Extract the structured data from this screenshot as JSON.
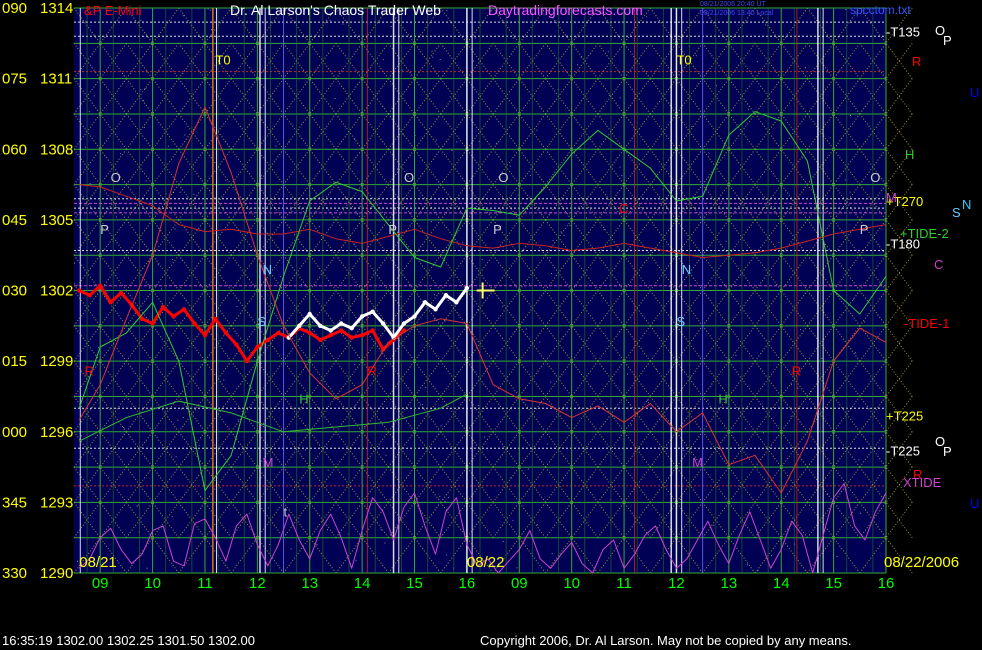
{
  "header": {
    "symbol": "&P E-Mini",
    "title": "Dr. Al Larson's Chaos Trader Web",
    "site": "Daytradingforecasts.com",
    "stamp1": "08/21/2006 20:40 UT",
    "stamp2": "08/21/2006 13:40 Local",
    "file": "spcctom.txt"
  },
  "footer": {
    "quote": "16:35:19  1302.00  1302.25  1301.50  1302.00",
    "copyright": "Copyright 2006, Dr. Al Larson. May not be copied by any means."
  },
  "colors": {
    "background": "#000055",
    "outer": "#000000",
    "yaxis_text": "#FFFF00",
    "time_text": "#00FF00",
    "price_line": "#FF0000",
    "price_bar_white": "#FFFFFF",
    "grid_green": "#33AA33",
    "grid_yellow": "#CCCC33",
    "tide_magenta": "#CC44CC"
  },
  "chart_data": {
    "type": "line",
    "title": "Dr. Al Larson's Chaos Trader Web",
    "ylim": [
      1290,
      1314
    ],
    "y_ticks": [
      {
        "deg": "090",
        "price": "1314",
        "value": 1314
      },
      {
        "deg": "075",
        "price": "1311",
        "value": 1311
      },
      {
        "deg": "060",
        "price": "1308",
        "value": 1308
      },
      {
        "deg": "045",
        "price": "1305",
        "value": 1305
      },
      {
        "deg": "030",
        "price": "1302",
        "value": 1302
      },
      {
        "deg": "015",
        "price": "1299",
        "value": 1299
      },
      {
        "deg": "000",
        "price": "1296",
        "value": 1296
      },
      {
        "deg": "345",
        "price": "1293",
        "value": 1293
      },
      {
        "deg": "330",
        "price": "1290",
        "value": 1290
      }
    ],
    "xlim": [
      8.5,
      24
    ],
    "x_ticks": [
      {
        "label": "09",
        "x": 9
      },
      {
        "label": "10",
        "x": 10
      },
      {
        "label": "11",
        "x": 11
      },
      {
        "label": "12",
        "x": 12
      },
      {
        "label": "13",
        "x": 13
      },
      {
        "label": "14",
        "x": 14
      },
      {
        "label": "15",
        "x": 15
      },
      {
        "label": "16",
        "x": 16
      },
      {
        "label": "09",
        "x": 17
      },
      {
        "label": "10",
        "x": 18
      },
      {
        "label": "11",
        "x": 19
      },
      {
        "label": "12",
        "x": 20
      },
      {
        "label": "13",
        "x": 21
      },
      {
        "label": "14",
        "x": 22
      },
      {
        "label": "15",
        "x": 23
      },
      {
        "label": "16",
        "x": 24
      }
    ],
    "date_labels": [
      {
        "text": "08/21",
        "x": 8.6
      },
      {
        "text": "08/22",
        "x": 16.0
      },
      {
        "text": "08/22/2006",
        "x": 24
      }
    ],
    "right_labels": [
      {
        "text": "-T135",
        "y": 1313.0,
        "color": "#FFFFFF"
      },
      {
        "text": "+T270",
        "y": 1305.8,
        "color": "#FFFF00"
      },
      {
        "text": "-T180",
        "y": 1304.0,
        "color": "#FFFFFF"
      },
      {
        "text": "+T225",
        "y": 1296.7,
        "color": "#FFFF00"
      },
      {
        "text": "-T225",
        "y": 1295.2,
        "color": "#FFFFFF"
      }
    ],
    "markers": [
      {
        "text": "T0",
        "x": 11.2,
        "y": 1311.6,
        "color": "#FFFF00"
      },
      {
        "text": "T0",
        "x": 20.0,
        "y": 1311.6,
        "color": "#FFFF00"
      },
      {
        "text": "O",
        "x": 9.2,
        "y": 1306.6,
        "color": "#CCCCCC"
      },
      {
        "text": "O",
        "x": 14.8,
        "y": 1306.6,
        "color": "#CCCCCC"
      },
      {
        "text": "O",
        "x": 16.6,
        "y": 1306.6,
        "color": "#CCCCCC"
      },
      {
        "text": "O",
        "x": 23.7,
        "y": 1306.6,
        "color": "#CCCCCC"
      },
      {
        "text": "P",
        "x": 9.0,
        "y": 1304.4,
        "color": "#CCCCCC"
      },
      {
        "text": "P",
        "x": 14.5,
        "y": 1304.4,
        "color": "#CCCCCC"
      },
      {
        "text": "P",
        "x": 16.5,
        "y": 1304.4,
        "color": "#CCCCCC"
      },
      {
        "text": "P",
        "x": 23.5,
        "y": 1304.4,
        "color": "#CCCCCC"
      },
      {
        "text": "N",
        "x": 12.1,
        "y": 1302.7,
        "color": "#66CCFF"
      },
      {
        "text": "N",
        "x": 20.1,
        "y": 1302.7,
        "color": "#66CCFF"
      },
      {
        "text": "S",
        "x": 12.0,
        "y": 1300.5,
        "color": "#66CCFF"
      },
      {
        "text": "S",
        "x": 20.0,
        "y": 1300.5,
        "color": "#66CCFF"
      },
      {
        "text": "R",
        "x": 8.7,
        "y": 1298.4,
        "color": "#FF0000"
      },
      {
        "text": "R",
        "x": 14.1,
        "y": 1298.4,
        "color": "#FF0000"
      },
      {
        "text": "R",
        "x": 22.2,
        "y": 1298.4,
        "color": "#FF0000"
      },
      {
        "text": "C",
        "x": 18.9,
        "y": 1305.3,
        "color": "#FF0000"
      },
      {
        "text": "H",
        "x": 12.8,
        "y": 1297.2,
        "color": "#33CC33"
      },
      {
        "text": "H",
        "x": 20.8,
        "y": 1297.2,
        "color": "#33CC33"
      },
      {
        "text": "M",
        "x": 12.1,
        "y": 1294.5,
        "color": "#CC44CC"
      },
      {
        "text": "M",
        "x": 20.3,
        "y": 1294.5,
        "color": "#CC44CC"
      },
      {
        "text": "t",
        "x": 12.5,
        "y": 1292.4,
        "color": "#CCCCCC"
      }
    ],
    "side_labels": [
      {
        "text": "O",
        "x": 935,
        "y": 35,
        "color": "#FFFFFF"
      },
      {
        "text": "P",
        "x": 943,
        "y": 45,
        "color": "#FFFFFF"
      },
      {
        "text": "R",
        "x": 912,
        "y": 66,
        "color": "#FF0000"
      },
      {
        "text": "U",
        "x": 970,
        "y": 97,
        "color": "#0000FF"
      },
      {
        "text": "H",
        "x": 905,
        "y": 159,
        "color": "#33CC33"
      },
      {
        "text": "M",
        "x": 886,
        "y": 202,
        "color": "#CC44CC"
      },
      {
        "text": "N",
        "x": 962,
        "y": 209,
        "color": "#33CCFF"
      },
      {
        "text": "S",
        "x": 952,
        "y": 217,
        "color": "#66CCFF"
      },
      {
        "text": "+TIDE-2",
        "x": 900,
        "y": 238,
        "color": "#33CC33"
      },
      {
        "text": "C",
        "x": 934,
        "y": 269,
        "color": "#CC44CC"
      },
      {
        "text": "-TIDE-1",
        "x": 904,
        "y": 328,
        "color": "#FF0000"
      },
      {
        "text": "O",
        "x": 935,
        "y": 446,
        "color": "#FFFFFF"
      },
      {
        "text": "P",
        "x": 943,
        "y": 456,
        "color": "#FFFFFF"
      },
      {
        "text": "R",
        "x": 913,
        "y": 479,
        "color": "#FF0000"
      },
      {
        "text": "XTIDE",
        "x": 903,
        "y": 487,
        "color": "#CC44CC"
      },
      {
        "text": "U",
        "x": 970,
        "y": 508,
        "color": "#0000FF"
      }
    ],
    "series": [
      {
        "color": "#FF0000",
        "x": [
          8.6,
          8.8,
          9.0,
          9.2,
          9.4,
          9.6,
          9.8,
          10.0,
          10.2,
          10.4,
          10.6,
          10.8,
          11.0,
          11.2,
          11.4,
          11.6,
          11.8,
          12.0,
          12.2,
          12.4,
          12.6,
          12.8,
          13.0,
          13.2,
          13.4,
          13.6,
          13.8,
          14.0,
          14.2,
          14.4,
          14.6,
          14.8
        ],
        "values": [
          1302.0,
          1301.8,
          1302.2,
          1301.5,
          1301.9,
          1301.4,
          1300.8,
          1300.6,
          1301.3,
          1300.9,
          1301.2,
          1300.6,
          1300.1,
          1300.8,
          1300.2,
          1299.7,
          1299.0,
          1299.6,
          1299.9,
          1300.2,
          1300.0,
          1300.4,
          1300.2,
          1299.9,
          1300.1,
          1300.3,
          1300.0,
          1300.1,
          1300.3,
          1299.5,
          1299.9,
          1300.3
        ]
      },
      {
        "color": "#FFFFFF",
        "x": [
          12.6,
          12.8,
          13.0,
          13.2,
          13.4,
          13.6,
          13.8,
          14.0,
          14.2,
          14.4,
          14.6,
          14.8,
          15.0,
          15.2,
          15.4,
          15.6,
          15.8,
          16.0
        ],
        "values": [
          1300.0,
          1300.5,
          1301.0,
          1300.5,
          1300.3,
          1300.6,
          1300.4,
          1300.9,
          1301.1,
          1300.6,
          1300.0,
          1300.6,
          1300.9,
          1301.5,
          1301.2,
          1301.8,
          1301.5,
          1302.1
        ]
      },
      {
        "color": "#CC2222",
        "x": [
          8.6,
          9.0,
          9.5,
          10.0,
          10.5,
          11.0,
          11.5,
          12.0,
          12.5,
          13.0,
          13.5,
          14.0,
          14.5,
          15.0,
          15.5,
          16.0,
          16.5,
          17.0,
          17.5,
          18.0,
          18.5,
          19.0,
          19.5,
          20.0,
          20.5,
          21.0,
          21.5,
          22.0,
          22.5,
          23.0,
          23.5,
          24.0
        ],
        "values": [
          1306.5,
          1306.4,
          1306.0,
          1305.6,
          1304.8,
          1304.5,
          1304.6,
          1304.4,
          1304.4,
          1304.6,
          1304.2,
          1304.0,
          1304.3,
          1304.6,
          1304.2,
          1303.9,
          1303.8,
          1304.0,
          1303.9,
          1303.7,
          1303.8,
          1304.0,
          1303.8,
          1303.6,
          1303.4,
          1303.5,
          1303.6,
          1303.8,
          1304.1,
          1304.4,
          1304.6,
          1304.8
        ]
      },
      {
        "color": "#33CC33",
        "x": [
          8.6,
          9.0,
          9.5,
          10.0,
          10.5,
          11.0,
          11.5,
          12.0,
          12.5,
          13.0,
          13.5,
          14.0,
          14.5,
          15.0,
          15.5,
          16.0,
          16.5,
          17.0,
          17.5,
          18.0,
          18.5,
          19.0,
          19.5,
          20.0,
          20.5,
          21.0,
          21.5,
          22.0,
          22.5,
          23.0,
          23.5,
          24.0
        ],
        "values": [
          1297.0,
          1299.6,
          1300.2,
          1301.5,
          1299.0,
          1293.5,
          1295.0,
          1299.0,
          1302.6,
          1305.8,
          1306.6,
          1306.2,
          1304.8,
          1303.4,
          1303.0,
          1305.5,
          1305.4,
          1305.2,
          1306.4,
          1307.8,
          1308.8,
          1308.0,
          1307.2,
          1305.8,
          1306.0,
          1308.6,
          1309.6,
          1309.2,
          1307.5,
          1302.0,
          1301.0,
          1302.6
        ]
      },
      {
        "color": "#DD3333",
        "x": [
          8.6,
          9.0,
          9.5,
          10.0,
          10.5,
          11.0,
          11.5,
          12.0,
          12.5,
          13.0,
          13.5,
          14.0,
          14.5,
          15.0,
          15.5,
          16.0,
          16.5,
          17.0,
          17.5,
          18.0,
          18.5,
          19.0,
          19.5,
          20.0,
          20.5,
          21.0,
          21.5,
          22.0,
          22.5,
          23.0,
          23.5,
          24.0
        ],
        "values": [
          1296.5,
          1298.0,
          1300.8,
          1303.5,
          1307.4,
          1309.8,
          1307.0,
          1303.5,
          1300.5,
          1298.5,
          1297.4,
          1298.0,
          1299.8,
          1300.5,
          1300.8,
          1300.6,
          1298.0,
          1297.4,
          1297.2,
          1296.6,
          1297.1,
          1296.4,
          1297.2,
          1296.0,
          1296.8,
          1294.6,
          1295.0,
          1293.4,
          1295.6,
          1299.0,
          1300.4,
          1299.8
        ]
      },
      {
        "color": "#33BB33",
        "x": [
          8.6,
          9.5,
          10.5,
          11.5,
          12.5,
          13.5,
          14.5,
          15.5,
          16.0
        ],
        "values": [
          1295.6,
          1296.6,
          1297.3,
          1296.8,
          1296.0,
          1296.2,
          1296.4,
          1297.0,
          1297.6
        ]
      },
      {
        "color": "#CC44CC",
        "x": [
          8.6,
          8.8,
          9.0,
          9.2,
          9.4,
          9.6,
          9.8,
          10.0,
          10.2,
          10.4,
          10.6,
          10.8,
          11.0,
          11.2,
          11.4,
          11.6,
          11.8,
          12.0,
          12.2,
          12.4,
          12.6,
          12.8,
          13.0,
          13.2,
          13.4,
          13.6,
          13.8,
          14.0,
          14.2,
          14.4,
          14.6,
          14.8,
          15.0,
          15.2,
          15.4,
          15.6,
          15.8,
          16.0,
          16.2,
          16.4,
          16.6,
          16.8,
          17.0,
          17.2,
          17.4,
          17.6,
          17.8,
          18.0,
          18.2,
          18.4,
          18.6,
          18.8,
          19.0,
          19.2,
          19.4,
          19.6,
          19.8,
          20.0,
          20.2,
          20.4,
          20.6,
          20.8,
          21.0,
          21.2,
          21.4,
          21.6,
          21.8,
          22.0,
          22.2,
          22.4,
          22.6,
          22.8,
          23.0,
          23.2,
          23.4,
          23.6,
          23.8,
          24.0
        ],
        "values": [
          1290.2,
          1290.6,
          1291.5,
          1291.9,
          1291.0,
          1290.4,
          1290.8,
          1291.8,
          1292.0,
          1290.5,
          1290.3,
          1292.1,
          1292.3,
          1291.5,
          1290.5,
          1292.0,
          1292.5,
          1291.2,
          1290.3,
          1291.2,
          1292.5,
          1291.4,
          1290.6,
          1291.8,
          1292.5,
          1291.5,
          1290.2,
          1291.8,
          1293.2,
          1292.6,
          1291.4,
          1292.8,
          1293.4,
          1292.0,
          1290.8,
          1292.6,
          1293.2,
          1291.2,
          1290.3,
          1290.6,
          1290.0,
          1290.5,
          1291.0,
          1291.8,
          1290.6,
          1290.2,
          1290.8,
          1291.3,
          1290.4,
          1290.0,
          1291.0,
          1291.4,
          1290.2,
          1290.8,
          1291.6,
          1292.0,
          1291.0,
          1290.2,
          1290.6,
          1291.4,
          1292.2,
          1291.2,
          1290.4,
          1291.6,
          1292.6,
          1291.4,
          1290.2,
          1291.0,
          1292.2,
          1291.6,
          1290.0,
          1291.6,
          1293.2,
          1293.8,
          1292.0,
          1291.4,
          1292.6,
          1293.4
        ]
      }
    ]
  }
}
